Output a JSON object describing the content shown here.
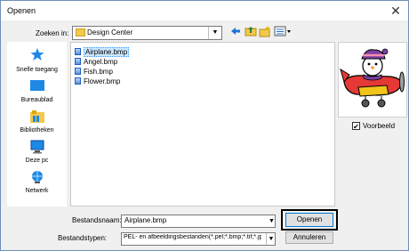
{
  "window": {
    "title": "Openen",
    "close_symbol": "✕"
  },
  "toolbar": {
    "look_in_label": "Zoeken in:",
    "look_in_value": "Design Center",
    "icons": [
      "back-icon",
      "up-folder-icon",
      "new-folder-icon",
      "view-menu-icon"
    ]
  },
  "places": [
    {
      "label": "Snelle toegang",
      "icon": "star-icon"
    },
    {
      "label": "Bureaublad",
      "icon": "desktop-icon"
    },
    {
      "label": "Bibliotheken",
      "icon": "libraries-icon"
    },
    {
      "label": "Deze pc",
      "icon": "computer-icon"
    },
    {
      "label": "Netwerk",
      "icon": "network-icon"
    }
  ],
  "files": [
    {
      "name": "Airplane.bmp",
      "selected": true
    },
    {
      "name": "Angel.bmp",
      "selected": false
    },
    {
      "name": "Fish.bmp",
      "selected": false
    },
    {
      "name": "Flower.bmp",
      "selected": false
    }
  ],
  "preview": {
    "checkbox_label": "Voorbeeld",
    "checked": true,
    "check_mark": "✔"
  },
  "form": {
    "filename_label": "Bestandsnaam:",
    "filename_value": "Airplane.bmp",
    "filetype_label": "Bestandstypen:",
    "filetype_value": "PEL- en afbeeldingsbestanden(*.pel;*.bmp;*.tif;*.jpg;*.",
    "dropdown_arrow": "▼"
  },
  "buttons": {
    "open": "Openen",
    "cancel": "Annuleren"
  },
  "colors": {
    "selection": "#cce8ff",
    "accent": "#0078d7"
  }
}
